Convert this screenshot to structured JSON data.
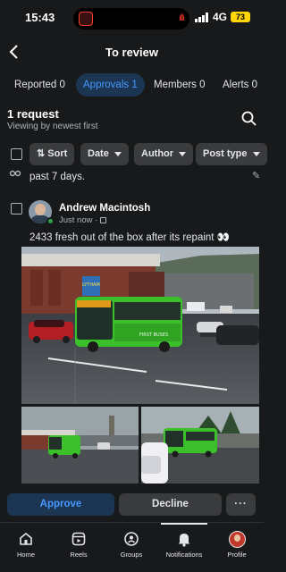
{
  "status_bar": {
    "time": "15:43",
    "network": "4G",
    "battery": "73"
  },
  "header": {
    "title": "To review"
  },
  "tabs": [
    {
      "label": "Reported 0",
      "active": false
    },
    {
      "label": "Approvals 1",
      "active": true
    },
    {
      "label": "Members 0",
      "active": false
    },
    {
      "label": "Alerts 0",
      "active": false
    }
  ],
  "summary": {
    "count": "1 request",
    "sort_note": "Viewing by newest first"
  },
  "filters": {
    "sort": "Sort",
    "date": "Date",
    "author": "Author",
    "post_type": "Post type"
  },
  "previous_post": {
    "text": "past 7 days."
  },
  "post": {
    "author": "Andrew Macintosh",
    "time": "Just now",
    "text": "2433 fresh out of the box after its repaint 👀",
    "bus_sign_text": "LYTHAM",
    "bus_side_text": "FIRST BUSES"
  },
  "actions": {
    "approve": "Approve",
    "decline": "Decline",
    "more": "···"
  },
  "nav": [
    {
      "label": "Home",
      "icon": "home-icon"
    },
    {
      "label": "Reels",
      "icon": "reels-icon"
    },
    {
      "label": "Groups",
      "icon": "groups-icon"
    },
    {
      "label": "Notifications",
      "icon": "bell-icon",
      "active": true
    },
    {
      "label": "Profile",
      "icon": "profile-avatar"
    }
  ],
  "colors": {
    "background": "#18191a",
    "accent": "#4599ff",
    "accent_bg": "#1b3552",
    "chip_bg": "#3a3b3c",
    "bus_green": "#3bbf2a"
  }
}
